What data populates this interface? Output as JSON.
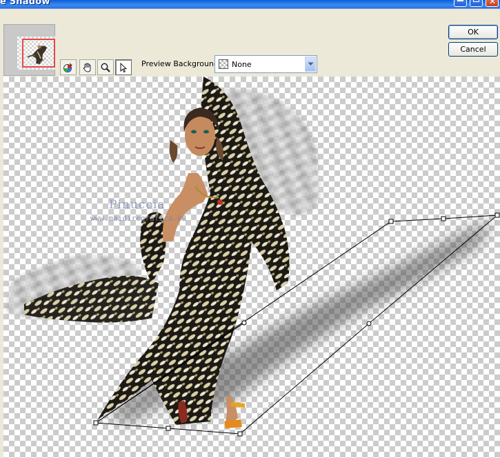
{
  "window": {
    "title": "e Shadow"
  },
  "dialog": {
    "ok_label": "OK",
    "cancel_label": "Cancel"
  },
  "toolbar": {
    "tools": [
      "color-wheel-icon",
      "hand-icon",
      "zoom-icon",
      "pointer-icon"
    ],
    "active_tool": "pointer-icon"
  },
  "preview_background": {
    "label": "Preview Background:",
    "value": "None"
  },
  "canvas": {
    "watermark_title": "Pinuccia",
    "watermark_url": "www.maidiregrafica.eu"
  },
  "colors": {
    "title_bar": "#0a5fd8",
    "thumbnail_frame": "#e34848",
    "dialog_face": "#ece9d8"
  }
}
